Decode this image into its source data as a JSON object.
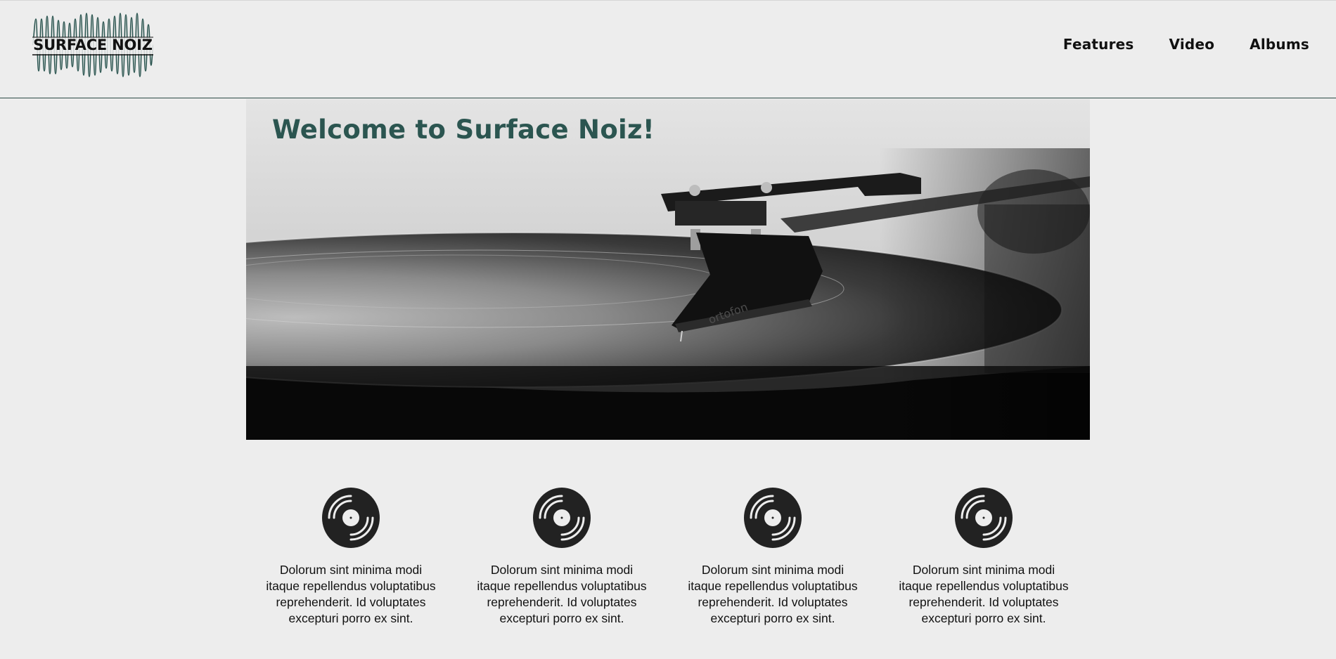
{
  "header": {
    "logo_text": "SURFACE NOIZ",
    "nav": [
      {
        "label": "Features"
      },
      {
        "label": "Video"
      },
      {
        "label": "Albums"
      }
    ]
  },
  "hero": {
    "title": "Welcome to Surface Noiz!",
    "image_icon": "turntable-photo",
    "cartridge_brand": "ortofon"
  },
  "features": [
    {
      "icon": "vinyl-record-icon",
      "text": "Dolorum sint minima modi itaque repellendus voluptatibus reprehenderit. Id voluptates excepturi porro ex sint."
    },
    {
      "icon": "vinyl-record-icon",
      "text": "Dolorum sint minima modi itaque repellendus voluptatibus reprehenderit. Id voluptates excepturi porro ex sint."
    },
    {
      "icon": "vinyl-record-icon",
      "text": "Dolorum sint minima modi itaque repellendus voluptatibus reprehenderit. Id voluptates excepturi porro ex sint."
    },
    {
      "icon": "vinyl-record-icon",
      "text": "Dolorum sint minima modi itaque repellendus voluptatibus reprehenderit. Id voluptates excepturi porro ex sint."
    }
  ],
  "colors": {
    "background": "#ededed",
    "accent": "#2b5550",
    "header_border": "#2b4a45",
    "text": "#111111"
  }
}
